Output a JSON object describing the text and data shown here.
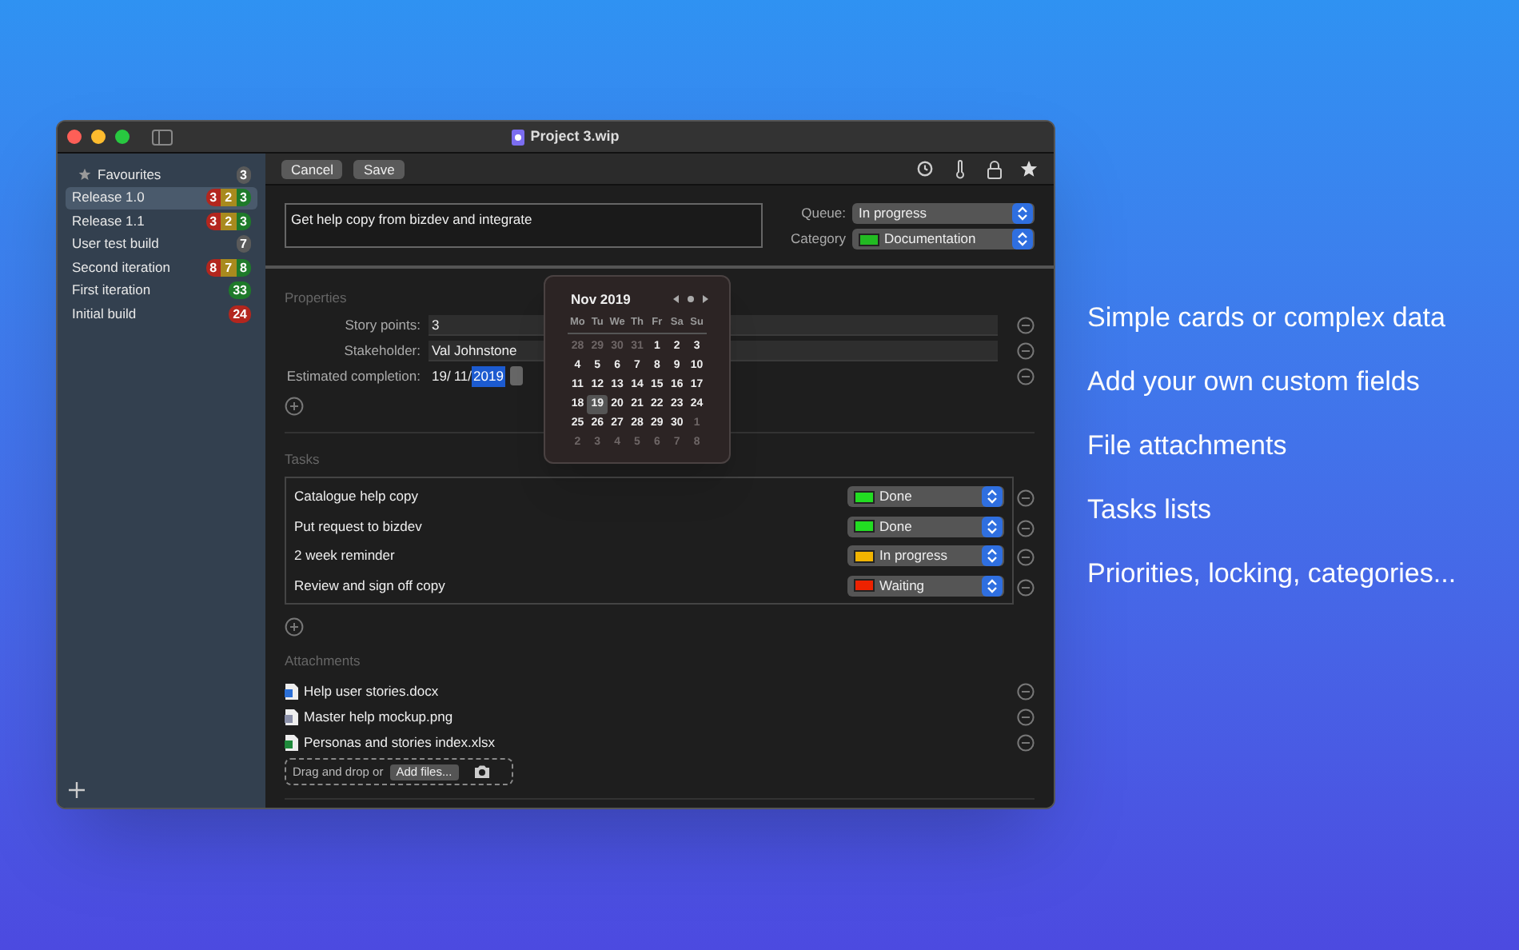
{
  "window": {
    "title": "Project 3.wip"
  },
  "sidebar": {
    "items": [
      {
        "label": "Favourites",
        "kind": "favourites",
        "selected": false,
        "badges": [
          {
            "text": "3",
            "color": "#5a5a5a"
          }
        ]
      },
      {
        "label": "Release 1.0",
        "selected": true,
        "badges": [
          {
            "text": "3",
            "color": "#b3261e"
          },
          {
            "text": "2",
            "color": "#a88a1e"
          },
          {
            "text": "3",
            "color": "#1e7a2a"
          }
        ]
      },
      {
        "label": "Release 1.1",
        "selected": false,
        "badges": [
          {
            "text": "3",
            "color": "#b3261e"
          },
          {
            "text": "2",
            "color": "#a88a1e"
          },
          {
            "text": "3",
            "color": "#1e7a2a"
          }
        ]
      },
      {
        "label": "User test build",
        "selected": false,
        "badges": [
          {
            "text": "7",
            "color": "#5a5a5a"
          }
        ]
      },
      {
        "label": "Second iteration",
        "selected": false,
        "badges": [
          {
            "text": "8",
            "color": "#b3261e"
          },
          {
            "text": "7",
            "color": "#a88a1e"
          },
          {
            "text": "8",
            "color": "#1e7a2a"
          }
        ]
      },
      {
        "label": "First iteration",
        "selected": false,
        "badges": [
          {
            "text": "33",
            "color": "#1e7a2a"
          }
        ]
      },
      {
        "label": "Initial build",
        "selected": false,
        "badges": [
          {
            "text": "24",
            "color": "#b3261e"
          }
        ]
      }
    ]
  },
  "toolbar": {
    "buttons": [
      "Cancel",
      "Save"
    ]
  },
  "card": {
    "title": "Get help copy from bizdev and integrate",
    "queue_label": "Queue:",
    "queue": "In progress",
    "category_label": "Category",
    "category": {
      "text": "Documentation",
      "color": "#22bb22"
    }
  },
  "properties": {
    "heading": "Properties",
    "fields": [
      {
        "label": "Story points:",
        "value": "3"
      },
      {
        "label": "Stakeholder:",
        "value": "Val Johnstone"
      }
    ],
    "date_label": "Estimated completion:",
    "date_day": "19/",
    "date_month": "11/",
    "date_year": "2019"
  },
  "calendar": {
    "month": "Nov 2019",
    "weekdays": [
      "Mo",
      "Tu",
      "We",
      "Th",
      "Fr",
      "Sa",
      "Su"
    ],
    "days": [
      {
        "text": "28",
        "muted": true,
        "selected": false
      },
      {
        "text": "29",
        "muted": true,
        "selected": false
      },
      {
        "text": "30",
        "muted": true,
        "selected": false
      },
      {
        "text": "31",
        "muted": true,
        "selected": false
      },
      {
        "text": "1",
        "muted": false,
        "selected": false
      },
      {
        "text": "2",
        "muted": false,
        "selected": false
      },
      {
        "text": "3",
        "muted": false,
        "selected": false
      },
      {
        "text": "4",
        "muted": false,
        "selected": false
      },
      {
        "text": "5",
        "muted": false,
        "selected": false
      },
      {
        "text": "6",
        "muted": false,
        "selected": false
      },
      {
        "text": "7",
        "muted": false,
        "selected": false
      },
      {
        "text": "8",
        "muted": false,
        "selected": false
      },
      {
        "text": "9",
        "muted": false,
        "selected": false
      },
      {
        "text": "10",
        "muted": false,
        "selected": false
      },
      {
        "text": "11",
        "muted": false,
        "selected": false
      },
      {
        "text": "12",
        "muted": false,
        "selected": false
      },
      {
        "text": "13",
        "muted": false,
        "selected": false
      },
      {
        "text": "14",
        "muted": false,
        "selected": false
      },
      {
        "text": "15",
        "muted": false,
        "selected": false
      },
      {
        "text": "16",
        "muted": false,
        "selected": false
      },
      {
        "text": "17",
        "muted": false,
        "selected": false
      },
      {
        "text": "18",
        "muted": false,
        "selected": false
      },
      {
        "text": "19",
        "muted": false,
        "selected": true
      },
      {
        "text": "20",
        "muted": false,
        "selected": false
      },
      {
        "text": "21",
        "muted": false,
        "selected": false
      },
      {
        "text": "22",
        "muted": false,
        "selected": false
      },
      {
        "text": "23",
        "muted": false,
        "selected": false
      },
      {
        "text": "24",
        "muted": false,
        "selected": false
      },
      {
        "text": "25",
        "muted": false,
        "selected": false
      },
      {
        "text": "26",
        "muted": false,
        "selected": false
      },
      {
        "text": "27",
        "muted": false,
        "selected": false
      },
      {
        "text": "28",
        "muted": false,
        "selected": false
      },
      {
        "text": "29",
        "muted": false,
        "selected": false
      },
      {
        "text": "30",
        "muted": false,
        "selected": false
      },
      {
        "text": "1",
        "muted": true,
        "selected": false
      },
      {
        "text": "2",
        "muted": true,
        "selected": false
      },
      {
        "text": "3",
        "muted": true,
        "selected": false
      },
      {
        "text": "4",
        "muted": true,
        "selected": false
      },
      {
        "text": "5",
        "muted": true,
        "selected": false
      },
      {
        "text": "6",
        "muted": true,
        "selected": false
      },
      {
        "text": "7",
        "muted": true,
        "selected": false
      },
      {
        "text": "8",
        "muted": true,
        "selected": false
      }
    ]
  },
  "tasks": {
    "heading": "Tasks",
    "items": [
      {
        "name": "Catalogue help copy",
        "status": "Done",
        "color": "#22dd22"
      },
      {
        "name": "Put request to bizdev",
        "status": "Done",
        "color": "#22dd22"
      },
      {
        "name": "2 week reminder",
        "status": "In progress",
        "color": "#f2b400"
      },
      {
        "name": "Review and sign off copy",
        "status": "Waiting",
        "color": "#ee2200"
      }
    ]
  },
  "attachments": {
    "heading": "Attachments",
    "items": [
      {
        "name": "Help user stories.docx",
        "kind": "document"
      },
      {
        "name": "Master help mockup.png",
        "kind": "image"
      },
      {
        "name": "Personas and stories index.xlsx",
        "kind": "spreadsheet"
      }
    ],
    "drop_text": "Drag and drop or",
    "add_button": "Add files..."
  },
  "features": [
    "Simple cards or complex data",
    "Add your own custom fields",
    "File attachments",
    "Tasks lists",
    "Priorities, locking, categories..."
  ]
}
